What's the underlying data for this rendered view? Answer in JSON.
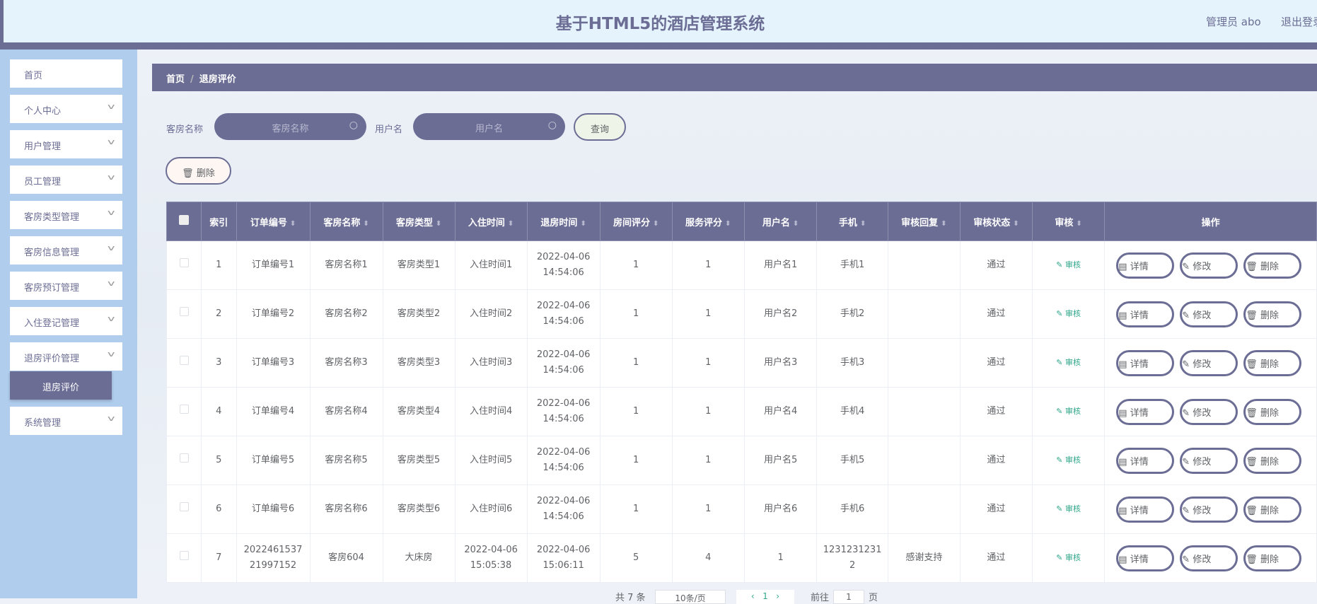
{
  "header": {
    "title": "基于HTML5的酒店管理系统",
    "user": "管理员 abo",
    "logout": "退出登录"
  },
  "sidebar": {
    "items": [
      {
        "label": "首页",
        "chevron": false
      },
      {
        "label": "个人中心",
        "chevron": true
      },
      {
        "label": "用户管理",
        "chevron": true
      },
      {
        "label": "员工管理",
        "chevron": true
      },
      {
        "label": "客房类型管理",
        "chevron": true
      },
      {
        "label": "客房信息管理",
        "chevron": true
      },
      {
        "label": "客房预订管理",
        "chevron": true
      },
      {
        "label": "入住登记管理",
        "chevron": true
      },
      {
        "label": "退房评价管理",
        "chevron": true
      },
      {
        "label": "系统管理",
        "chevron": true
      }
    ],
    "active_sub": "退房评价"
  },
  "breadcrumb": {
    "home": "首页",
    "sep": "/",
    "current": "退房评价"
  },
  "search": {
    "room_label": "客房名称",
    "room_placeholder": "客房名称",
    "user_label": "用户名",
    "user_placeholder": "用户名",
    "query": "查询"
  },
  "toolbar": {
    "delete": "删除"
  },
  "table": {
    "headers": [
      "索引",
      "订单编号",
      "客房名称",
      "客房类型",
      "入住时间",
      "退房时间",
      "房间评分",
      "服务评分",
      "用户名",
      "手机",
      "审核回复",
      "审核状态",
      "审核",
      "操作"
    ],
    "rows": [
      [
        "1",
        "订单编号1",
        "客房名称1",
        "客房类型1",
        "入住时间1",
        "2022-04-06 14:54:06",
        "1",
        "1",
        "用户名1",
        "手机1",
        "",
        "通过"
      ],
      [
        "2",
        "订单编号2",
        "客房名称2",
        "客房类型2",
        "入住时间2",
        "2022-04-06 14:54:06",
        "1",
        "1",
        "用户名2",
        "手机2",
        "",
        "通过"
      ],
      [
        "3",
        "订单编号3",
        "客房名称3",
        "客房类型3",
        "入住时间3",
        "2022-04-06 14:54:06",
        "1",
        "1",
        "用户名3",
        "手机3",
        "",
        "通过"
      ],
      [
        "4",
        "订单编号4",
        "客房名称4",
        "客房类型4",
        "入住时间4",
        "2022-04-06 14:54:06",
        "1",
        "1",
        "用户名4",
        "手机4",
        "",
        "通过"
      ],
      [
        "5",
        "订单编号5",
        "客房名称5",
        "客房类型5",
        "入住时间5",
        "2022-04-06 14:54:06",
        "1",
        "1",
        "用户名5",
        "手机5",
        "",
        "通过"
      ],
      [
        "6",
        "订单编号6",
        "客房名称6",
        "客房类型6",
        "入住时间6",
        "2022-04-06 14:54:06",
        "1",
        "1",
        "用户名6",
        "手机6",
        "",
        "通过"
      ],
      [
        "7",
        "202246153721997152",
        "客房604",
        "大床房",
        "2022-04-06 15:05:38",
        "2022-04-06 15:06:11",
        "5",
        "4",
        "1",
        "12312312312",
        "感谢支持",
        "通过"
      ]
    ],
    "audit_label": "审核",
    "detail": "详情",
    "edit": "修改",
    "delete": "删除"
  },
  "pagination": {
    "total": "共 7 条",
    "page_size": "10条/页",
    "current": "1",
    "goto": "前往",
    "goto_value": "1",
    "page_suffix": "页"
  }
}
